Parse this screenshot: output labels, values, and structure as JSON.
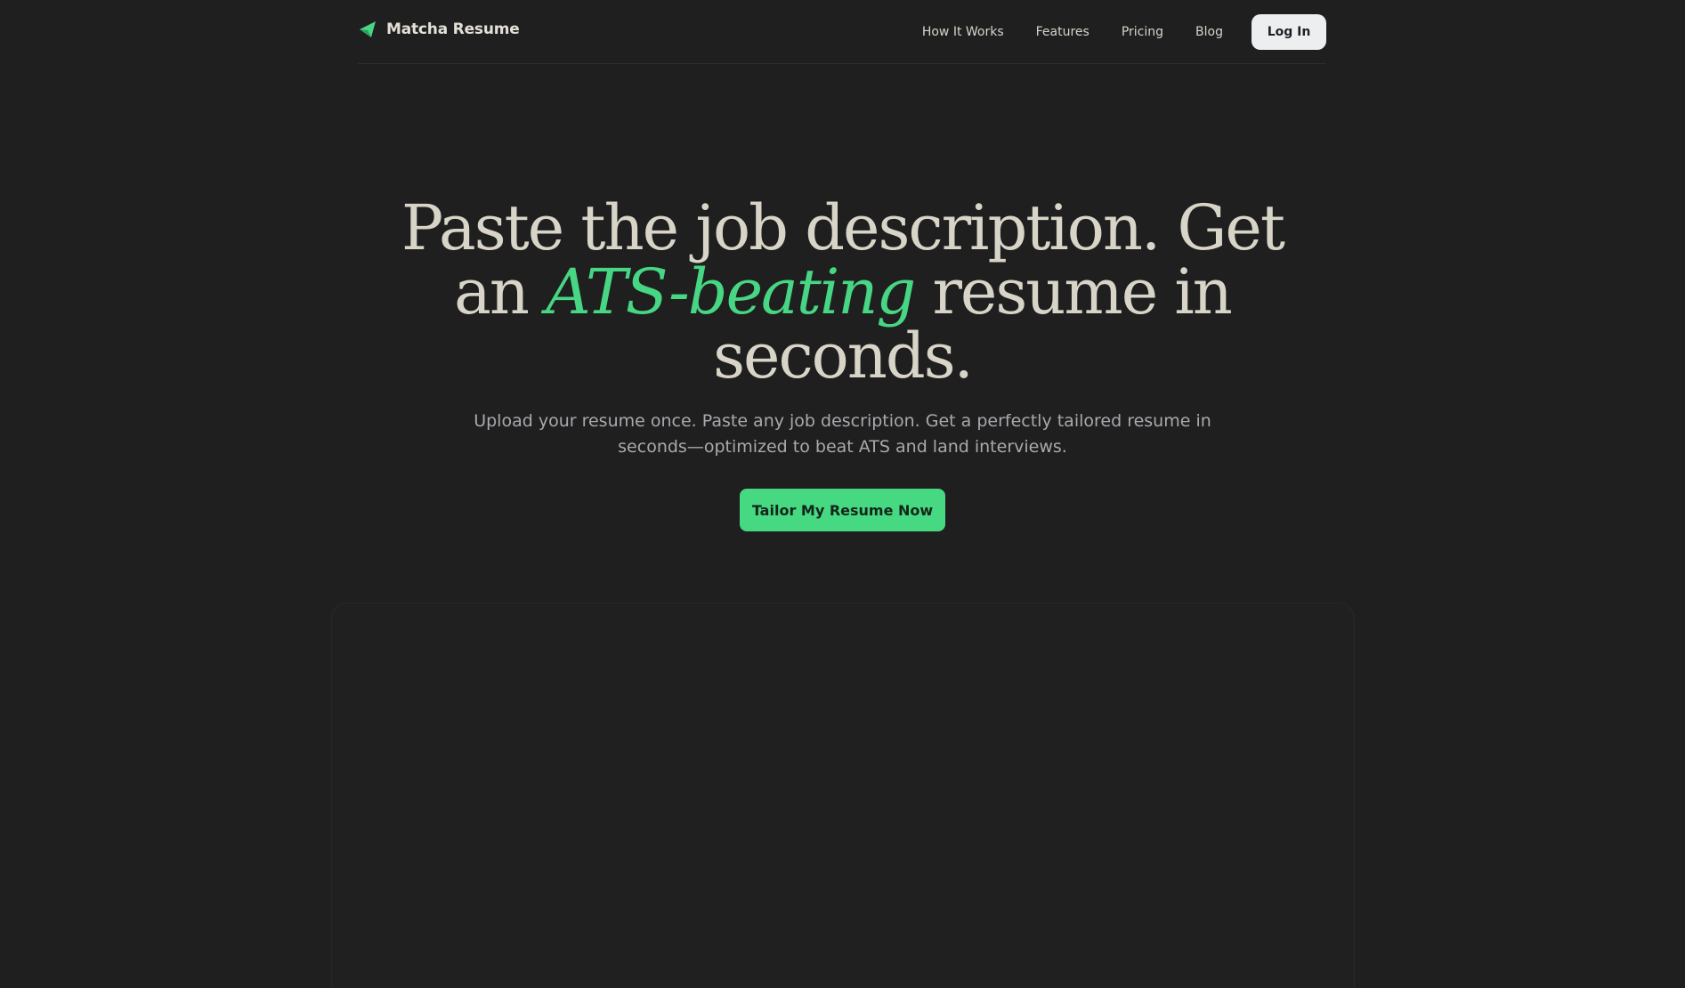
{
  "brand": {
    "name": "Matcha Resume",
    "icon": "paper-plane-icon",
    "accent_color": "#47d683"
  },
  "nav": {
    "links": [
      "How It Works",
      "Features",
      "Pricing",
      "Blog"
    ],
    "login_label": "Log In"
  },
  "hero": {
    "title_line1": "Paste the job description. Get",
    "title_line2_pre": "an ",
    "title_accent": "ATS-beating",
    "title_line2_post": " resume in",
    "title_line3": "seconds.",
    "subtitle": "Upload your resume once. Paste any job description. Get a perfectly tailored resume in seconds—optimized to beat ATS and land interviews.",
    "cta_label": "Tailor My Resume Now"
  },
  "colors": {
    "background": "#1f1f1f",
    "cta": "#46d981",
    "login_bg": "#eceef0"
  }
}
